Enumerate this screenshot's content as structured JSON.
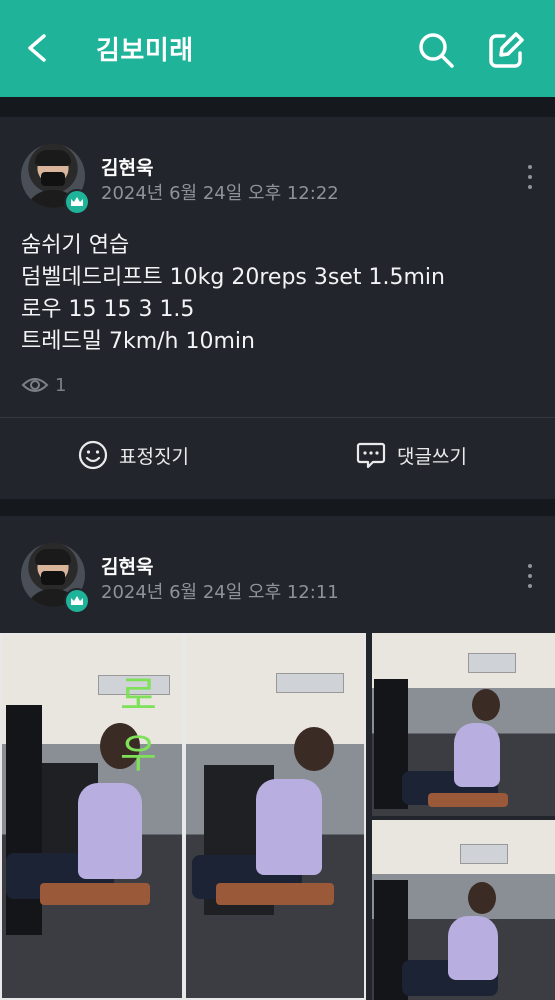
{
  "header": {
    "title": "김보미래",
    "back_icon": "back-arrow-icon",
    "search_icon": "search-icon",
    "edit_icon": "edit-icon",
    "bg_color": "#1fb39a"
  },
  "posts": [
    {
      "author": "김현욱",
      "date": "2024년 6월 24일 오후 12:22",
      "content_lines": [
        "숨쉬기 연습",
        "덤벨데드리프트 10kg 20reps 3set 1.5min",
        "로우 15 15 3 1.5",
        "트레드밀 7km/h 10min"
      ],
      "views": "1",
      "actions": {
        "react_label": "표정짓기",
        "comment_label": "댓글쓰기"
      }
    },
    {
      "author": "김현욱",
      "date": "2024년 6월 24일 오후 12:11",
      "photo_annotation": "로우"
    }
  ]
}
